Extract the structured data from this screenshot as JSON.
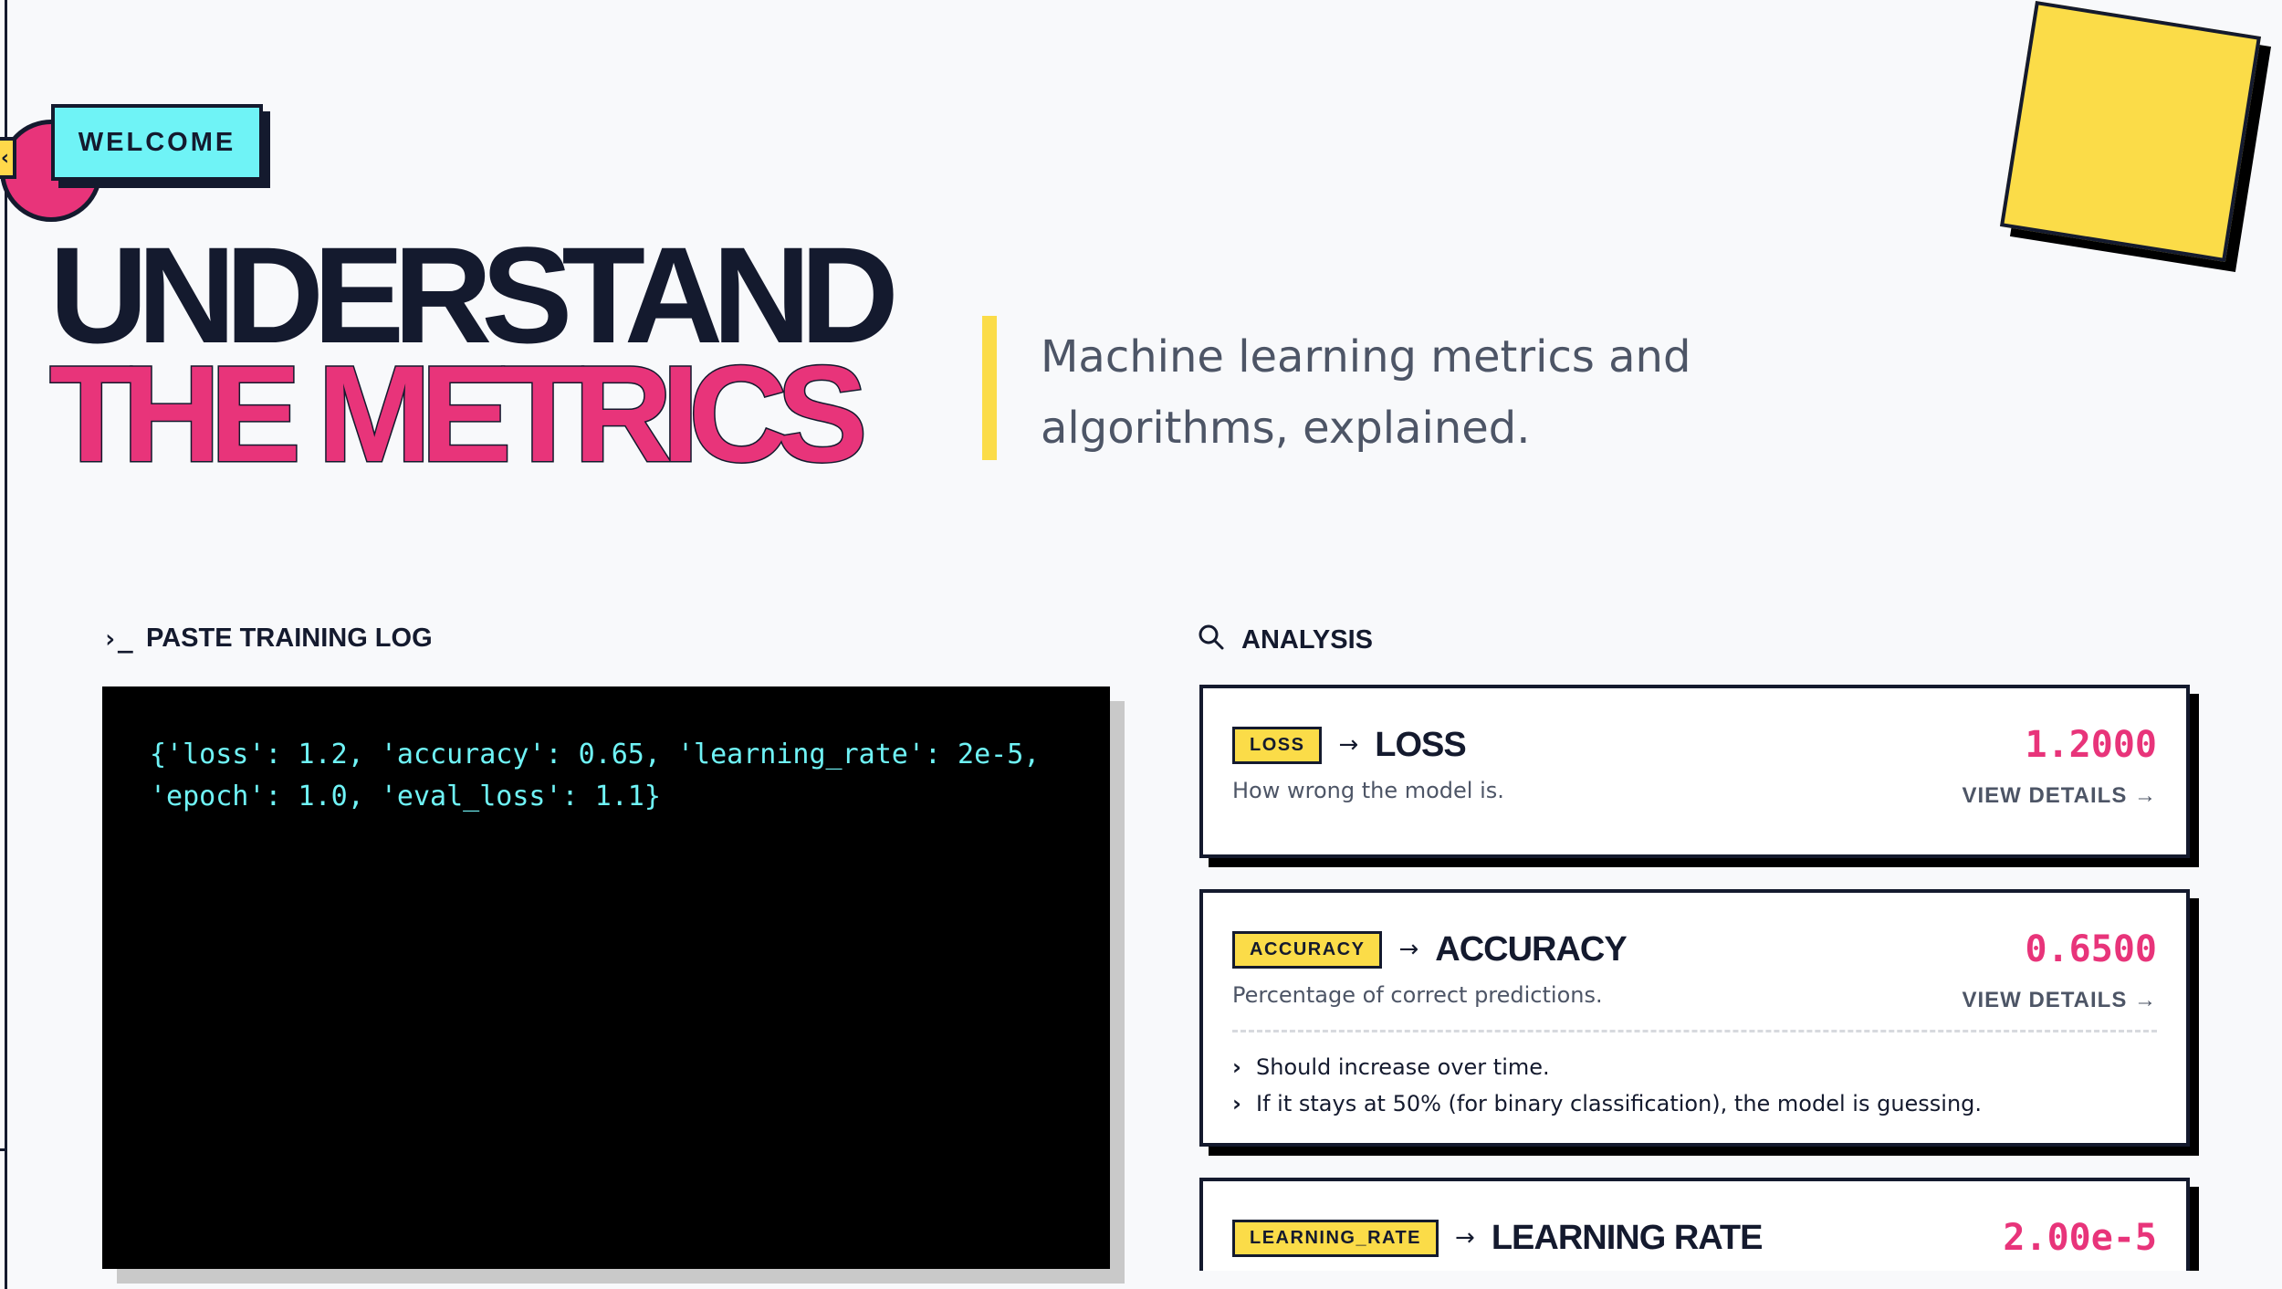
{
  "hero": {
    "badge": "WELCOME",
    "title_line1": "UNDERSTAND",
    "title_line2": "THE METRICS",
    "subtitle_line1": "Machine learning metrics and",
    "subtitle_line2": "algorithms, explained."
  },
  "input_panel": {
    "icon": "terminal-icon",
    "heading": "PASTE TRAINING LOG",
    "log_line1": "{'loss': 1.2, 'accuracy': 0.65, 'learning_rate': 2e-5,",
    "log_line2": "'epoch': 1.0, 'eval_loss': 1.1}"
  },
  "analysis_panel": {
    "icon": "search-icon",
    "heading": "ANALYSIS",
    "cards": [
      {
        "tag": "LOSS",
        "title": "LOSS",
        "value": "1.2000",
        "description": "How wrong the model is.",
        "link": "VIEW DETAILS →"
      },
      {
        "tag": "ACCURACY",
        "title": "ACCURACY",
        "value": "0.6500",
        "description": "Percentage of correct predictions.",
        "link": "VIEW DETAILS →",
        "notes": [
          "Should increase over time.",
          "If it stays at 50% (for binary classification), the model is guessing."
        ]
      },
      {
        "tag": "LEARNING_RATE",
        "title": "LEARNING RATE",
        "value": "2.00e-5"
      }
    ]
  },
  "colors": {
    "background": "#f8f9fb",
    "ink": "#141a2e",
    "accent_pink": "#e8347a",
    "accent_yellow": "#fbdc48",
    "accent_cyan": "#6ff3f6"
  }
}
